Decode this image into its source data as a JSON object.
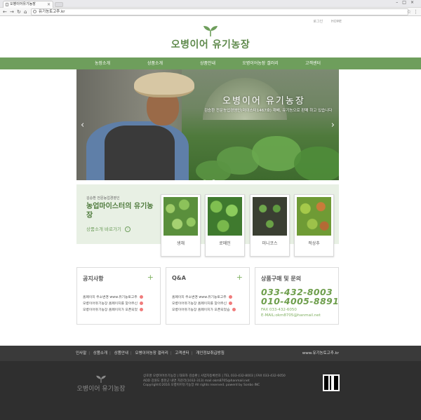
{
  "browser": {
    "tab_title": "오병이어유기농장",
    "url": "유기농토고추.kr"
  },
  "top_links": [
    "로그인",
    "HOME"
  ],
  "logo": {
    "text": "오병이어 유기농장"
  },
  "gnb": {
    "items": [
      "농장소개",
      "상품소개",
      "상품안내",
      "오병이어농장 갤러리",
      "고객센터"
    ]
  },
  "hero": {
    "title": "오병이어 유기농장",
    "subtitle": "김승환 전문농업경영인(마이스터1467호) 재배, 유기농으로 판매 하고 있습니다",
    "prev": "‹",
    "next": "›"
  },
  "promo": {
    "small": "김승환 전문농업경영인",
    "title": "농업마이스터의 유기농장",
    "link": "상품소개 바로가기",
    "link_arrow": "›"
  },
  "products": [
    {
      "label": "생채"
    },
    {
      "label": "로메인"
    },
    {
      "label": "미니코스"
    },
    {
      "label": "적상추"
    }
  ],
  "notice": {
    "title": "공지사항",
    "plus": "+",
    "items": [
      "홈페이지 주소변경 www.유기농토고추",
      "오병이어유기농장 홈페이지를 찾아주신",
      "오병이어유기농장 홈페이지가 오픈되었"
    ]
  },
  "qna": {
    "title": "Q&A",
    "plus": "+",
    "items": [
      "홈페이지 주소변경 www.유기농토고추",
      "오병이어유기농장 홈페이지를 찾아주신",
      "오병이어유기농장 홈페이지가 오픈되었습"
    ]
  },
  "contact": {
    "title": "상품구매 및 문의",
    "phone1": "033-432-8003",
    "phone2": "010-4005-8891",
    "fax": "FAX 033-432-6050",
    "email": "E-MAIL:okm8705@hanmail.net"
  },
  "footer_nav": {
    "links": [
      "인사말",
      "상품소개",
      "상품안내",
      "오병이어농장 갤러리",
      "고객센터",
      "개인정보취급방침"
    ],
    "domain": "www.유기농토고추.kr"
  },
  "footer": {
    "logo_text": "오병이어 유기농장",
    "line1": "상호명 오병이어유기농장 | 대표자 김승환 | 사업자등록번호 | TEL 033-432-8003 | FAX 033-432-6050",
    "line2": "ADD 강원도 홍천군 내면 자운리(1032-313) mail okm8705@hanmail.net",
    "line3": "Copyright©2016 오병이어유기농장 All rights reserved. powerd by Sonbo INC"
  },
  "colors": {
    "brand_green": "#6e9e5c",
    "phone_green": "#6e9e4c",
    "footer_dark": "#2f2f2f"
  }
}
